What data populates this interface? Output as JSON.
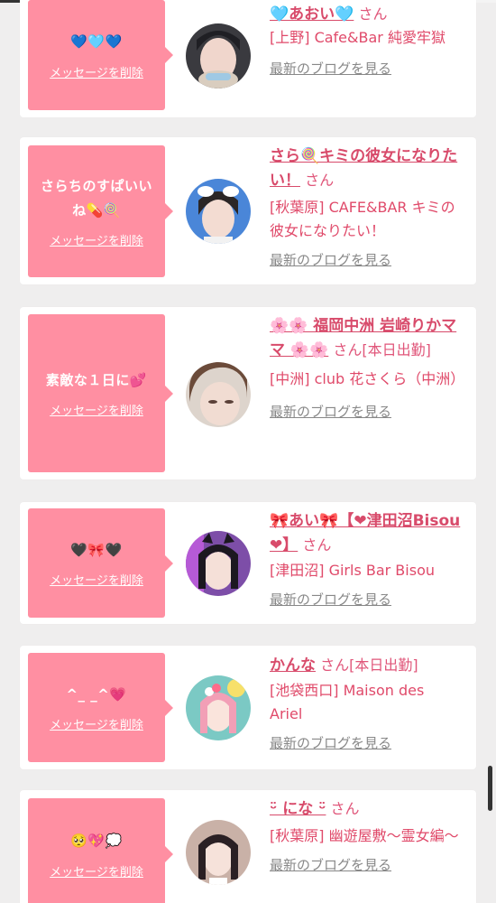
{
  "messages": [
    {
      "message": "💙🩵💙",
      "delete_label": "メッセージを削除",
      "name": "🩵あおい🩵",
      "honorific": "さん",
      "shop": "[上野] Cafe&Bar 純愛牢獄",
      "blog_label": "最新のブログを見る",
      "avatar_icon": "avatar-photo-icon"
    },
    {
      "message": "さらちのすぱいいね💊🍭",
      "delete_label": "メッセージを削除",
      "name": "さら🍭キミの彼女になりたい！",
      "honorific": "さん",
      "shop": "[秋葉原] CAFE&BAR キミの彼女になりたい！",
      "blog_label": "最新のブログを見る",
      "avatar_icon": "avatar-photo-icon"
    },
    {
      "message": "素敵な１日に💕",
      "delete_label": "メッセージを削除",
      "name": "🌸🌸 福岡中洲 岩崎りかママ 🌸🌸",
      "honorific": "さん[本日出勤]",
      "shop": "[中洲] club 花さくら（中洲）",
      "blog_label": "最新のブログを見る",
      "avatar_icon": "avatar-photo-icon"
    },
    {
      "message": "🖤🎀🖤",
      "delete_label": "メッセージを削除",
      "name": "🎀あい🎀【❤津田沼Bisou❤】",
      "honorific": "さん",
      "shop": "[津田沼] Girls Bar Bisou",
      "blog_label": "最新のブログを見る",
      "avatar_icon": "avatar-photo-icon"
    },
    {
      "message": "^_ _^💗",
      "delete_label": "メッセージを削除",
      "name": "かんな",
      "honorific": "さん[本日出勤]",
      "shop": "[池袋西口] Maison des Ariel",
      "blog_label": "最新のブログを見る",
      "avatar_icon": "avatar-photo-icon"
    },
    {
      "message": "🥺💖💭",
      "delete_label": "メッセージを削除",
      "name": "ᵕ̈ にな ᵕ̈",
      "honorific": "さん",
      "shop": "[秋葉原] 幽遊屋敷〜霊女編〜",
      "blog_label": "最新のブログを見る",
      "avatar_icon": "avatar-photo-icon"
    }
  ],
  "colors": {
    "bubble": "#ff8fa2",
    "name_pink": "#d84b6b",
    "background": "#efeeee"
  }
}
